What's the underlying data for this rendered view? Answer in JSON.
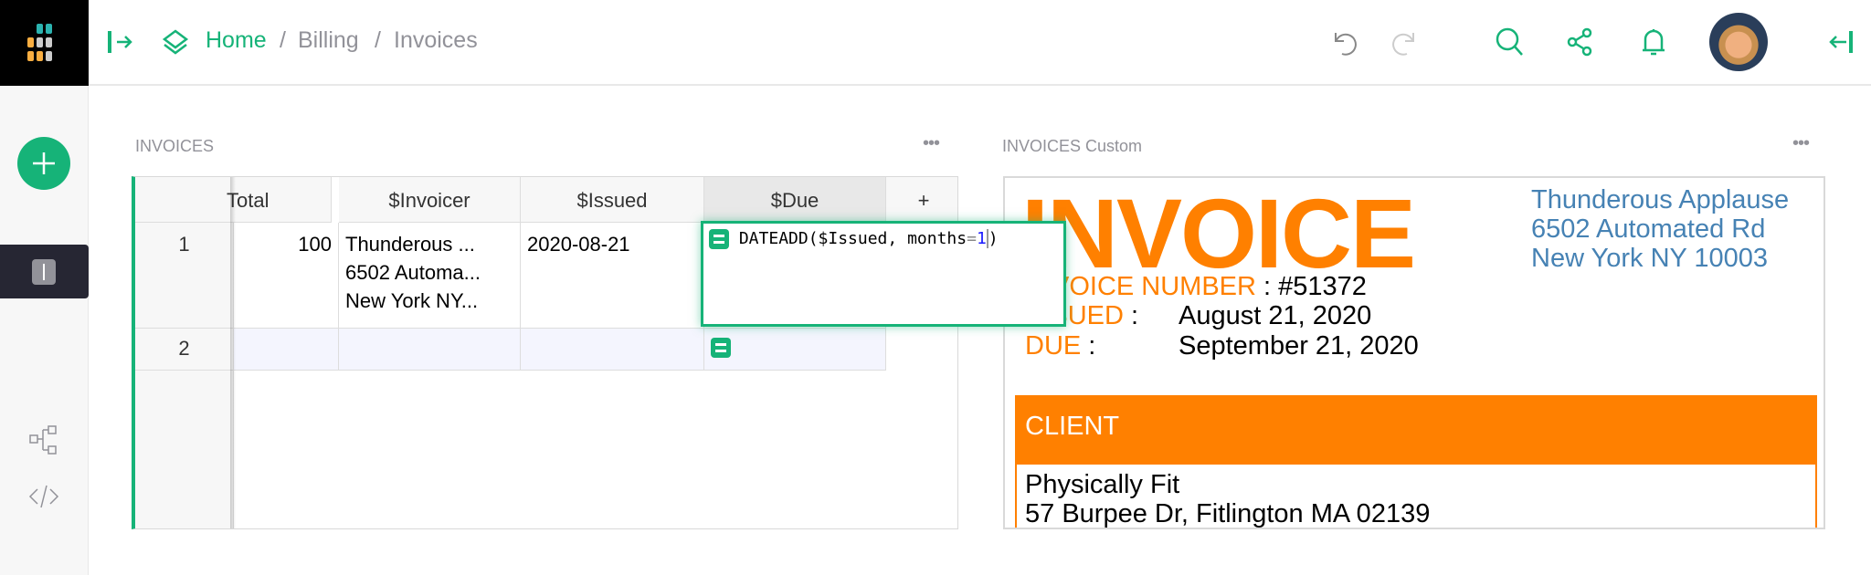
{
  "header": {
    "breadcrumb": [
      "Home",
      "Billing",
      "Invoices"
    ],
    "separator": "/"
  },
  "icons": {
    "logo": "grist-logo",
    "left_panel": "panel-open-icon",
    "layers": "layers-icon",
    "undo": "undo-icon",
    "redo": "redo-icon",
    "search": "search-icon",
    "share": "share-icon",
    "bell": "bell-icon",
    "avatar": "user-avatar",
    "right_panel": "panel-collapse-icon"
  },
  "colors": {
    "accent": "#16b378",
    "invoice_orange": "#ff8000",
    "address_blue": "#4682b4"
  },
  "grid_section": {
    "title": "INVOICES",
    "menu": "•••",
    "columns": [
      "Total",
      "$Invoicer",
      "$Issued",
      "$Due",
      "+"
    ],
    "rows": [
      {
        "num": "1",
        "total": "100",
        "invoicer": [
          "Thunderous ...",
          "6502 Automa...",
          "New York NY..."
        ],
        "issued": "2020-08-21"
      },
      {
        "num": "2"
      }
    ],
    "editor": {
      "func": "DATEADD($Issued, months",
      "op": "=",
      "num": "1",
      "close": ")"
    }
  },
  "custom_section": {
    "title": "INVOICES Custom",
    "menu": "•••",
    "heading": "INVOICE",
    "from": [
      "Thunderous Applause",
      "6502 Automated Rd",
      "New York NY 10003"
    ],
    "number_label": "INVOICE NUMBER",
    "number_value": ": #51372",
    "issued_label": "ISSUED",
    "issued_colon": ":",
    "issued_value": "August 21, 2020",
    "due_label": "DUE",
    "due_colon": ":",
    "due_value": "September 21, 2020",
    "client_label": "CLIENT",
    "client": [
      "Physically Fit",
      "57 Burpee Dr, Fitlington MA 02139"
    ]
  }
}
